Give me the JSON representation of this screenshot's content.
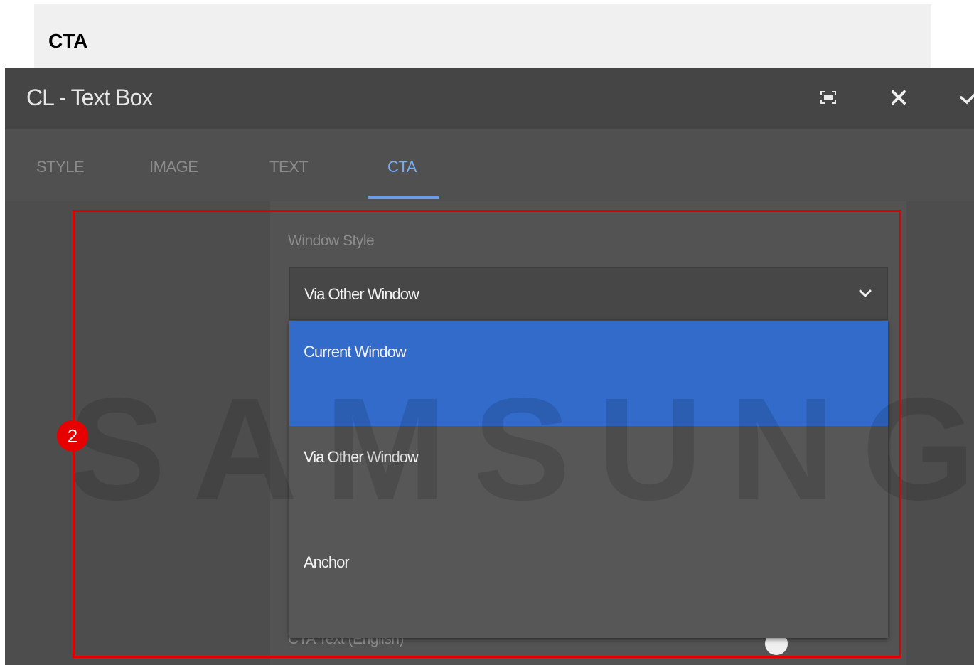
{
  "page": {
    "heading": "CTA"
  },
  "dialog": {
    "title": "CL - Text Box",
    "buttons": {
      "fullscreen_icon": "fullscreen-icon",
      "close_icon": "close-icon",
      "confirm_icon": "check-icon"
    },
    "tabs": [
      {
        "label": "STYLE",
        "active": false
      },
      {
        "label": "IMAGE",
        "active": false
      },
      {
        "label": "TEXT",
        "active": false
      },
      {
        "label": "CTA",
        "active": true
      }
    ],
    "window_style": {
      "label": "Window Style",
      "selected_value": "Via Other Window",
      "options": [
        {
          "label": "Current Window",
          "highlighted": true
        },
        {
          "label": "Via Other Window",
          "highlighted": false
        },
        {
          "label": "Anchor",
          "highlighted": false
        }
      ]
    },
    "cta_text": {
      "label": "CTA Text (English)"
    }
  },
  "overlay": {
    "watermark": "SAMSUNG",
    "annotation_number": "2",
    "annotation_color": "#e00000"
  },
  "colors": {
    "accent": "#326bc9",
    "active_tab": "#7aaaf0"
  }
}
